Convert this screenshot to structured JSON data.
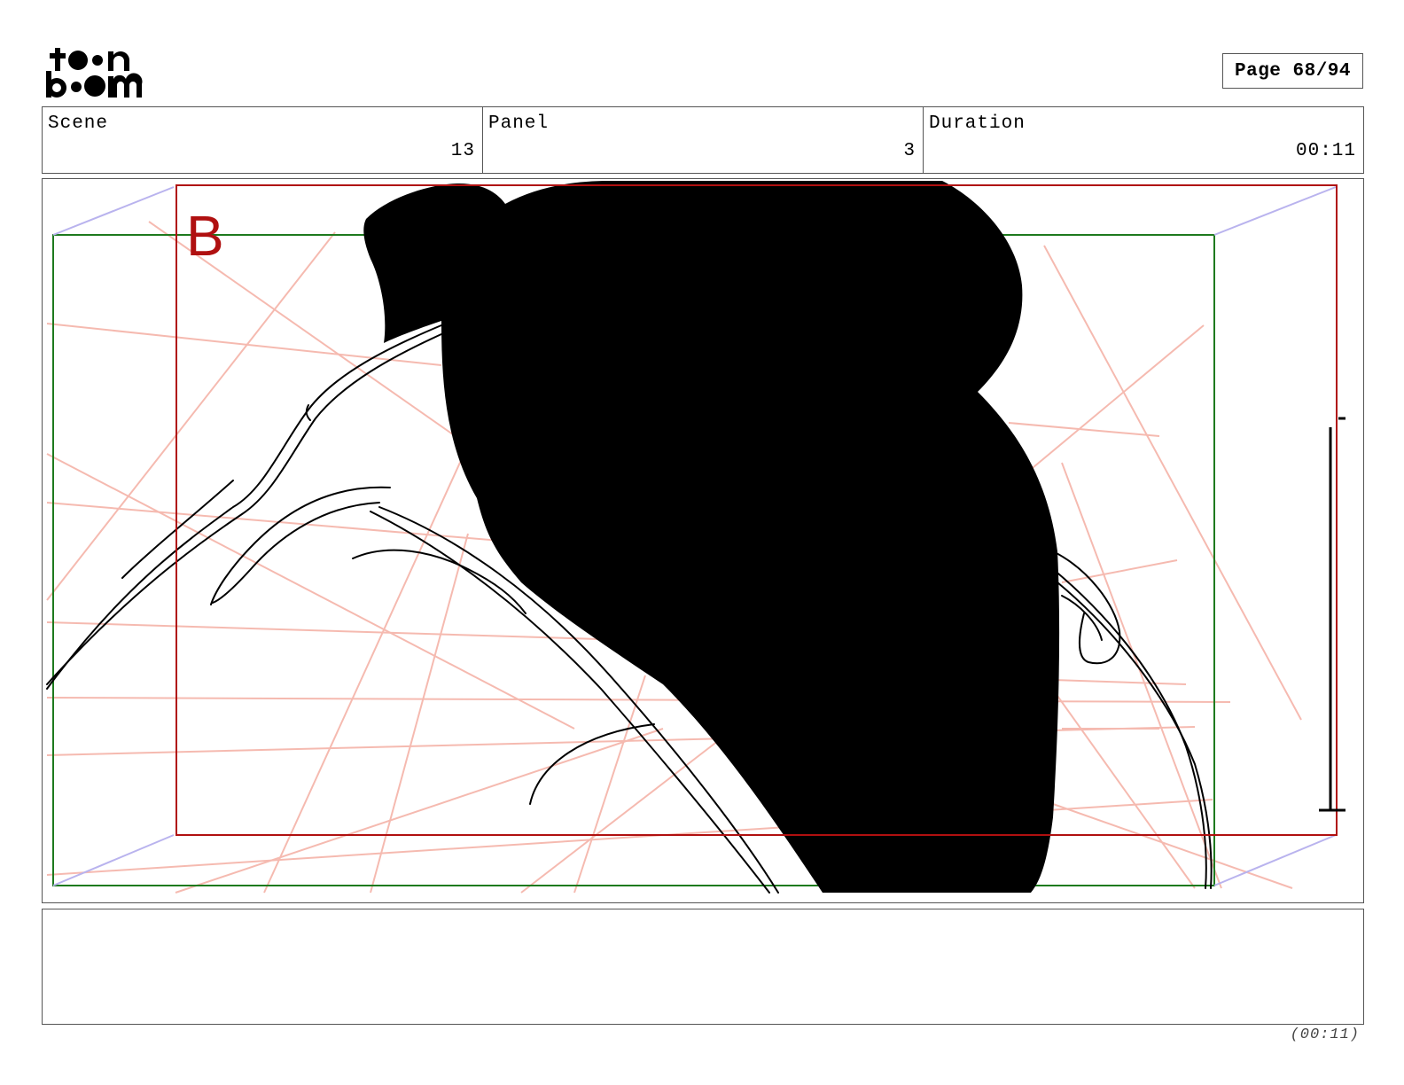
{
  "header": {
    "logo_text": "toonboom",
    "page_label": "Page 68/94"
  },
  "info": {
    "scene_label": "Scene",
    "scene_value": "13",
    "panel_label": "Panel",
    "panel_value": "3",
    "duration_label": "Duration",
    "duration_value": "00:11"
  },
  "panel": {
    "camera_label": "B",
    "colors": {
      "camera_frame_red": "#b01010",
      "field_frame_green": "#1e7a1e",
      "guide_lines": "#f5b3a8",
      "camera_arrows": "#b9b3ee"
    }
  },
  "notes": {
    "text": ""
  },
  "footer": {
    "duration": "(00:11)"
  }
}
